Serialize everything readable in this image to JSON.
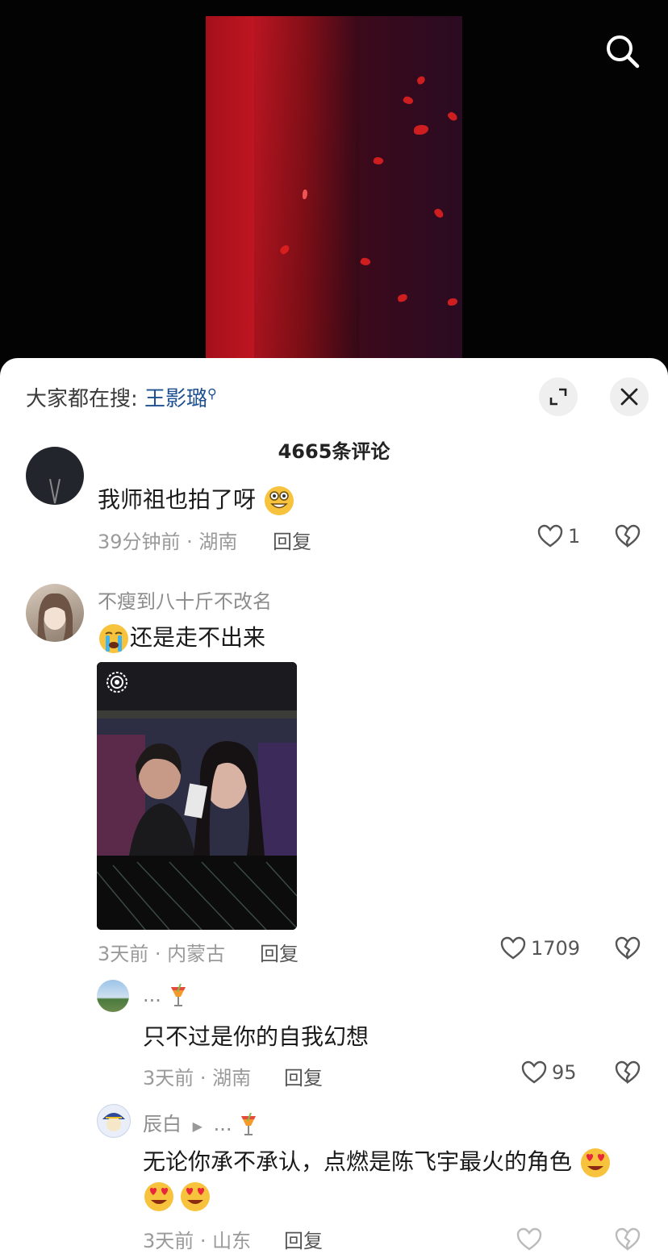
{
  "trending": {
    "prefix": "大家都在搜:",
    "keyword": "王影璐"
  },
  "comments_count": "4665条评论",
  "comments": [
    {
      "text": "我师祖也拍了呀",
      "meta": "39分钟前 · 湖南",
      "reply": "回复",
      "likes": "1"
    },
    {
      "name": "不瘦到八十斤不改名",
      "text": "还是走不出来",
      "meta": "3天前 · 内蒙古",
      "reply": "回复",
      "likes": "1709"
    }
  ],
  "replies": [
    {
      "name": "...",
      "text": "只不过是你的自我幻想",
      "meta": "3天前 · 湖南",
      "reply": "回复",
      "likes": "95"
    },
    {
      "name": "辰白",
      "to": "...",
      "text_line1": "无论你承不承认，点燃是陈飞宇最火的角色",
      "meta": "3天前 · 山东",
      "reply": "回复"
    }
  ],
  "icons": {
    "search": "search-icon",
    "expand": "expand-icon",
    "close": "close-icon",
    "heart": "heart-icon",
    "broken_heart": "broken-heart-icon",
    "live_photo": "live-photo-icon",
    "emoji_grin": "grinning-emoji",
    "emoji_cry": "crying-emoji",
    "emoji_heart_eyes": "heart-eyes-emoji",
    "cocktail": "cocktail-emoji"
  },
  "colors": {
    "keyword": "#1d4f91",
    "meta": "#9a9a9a",
    "text": "#1a1a1a"
  }
}
